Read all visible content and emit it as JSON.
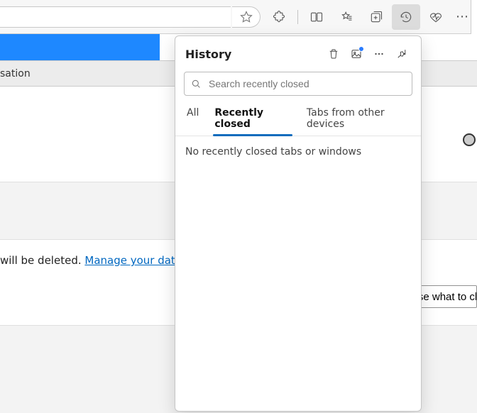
{
  "toolbar": {
    "star_tooltip": "Add to favorites",
    "ext_tooltip": "Extensions",
    "split_tooltip": "Split screen",
    "favorites_tooltip": "Favorites",
    "collections_tooltip": "Collections",
    "history_tooltip": "History",
    "perf_tooltip": "Browser essentials",
    "more_tooltip": "Settings and more"
  },
  "background": {
    "tab_text_fragment": "sation",
    "data_line_fragment": "will be deleted. ",
    "data_link": "Manage your data",
    "choose_button_fragment": "Choose what to cl"
  },
  "history": {
    "title": "History",
    "delete_tooltip": "Delete browsing data",
    "image_tooltip": "History image",
    "more_tooltip": "More options",
    "pin_tooltip": "Pin history",
    "search_placeholder": "Search recently closed",
    "tabs": {
      "all": "All",
      "recent": "Recently closed",
      "other": "Tabs from other devices"
    },
    "empty_message": "No recently closed tabs or windows"
  }
}
